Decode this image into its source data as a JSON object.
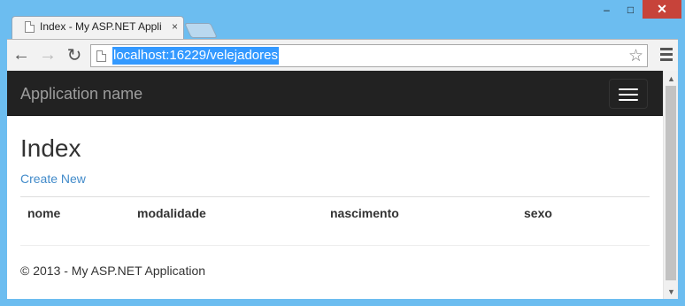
{
  "tab": {
    "title": "Index - My ASP.NET Appli",
    "close": "×"
  },
  "window": {
    "minimize": "–",
    "maximize": "□",
    "close": "✕"
  },
  "toolbar": {
    "back": "←",
    "forward": "→",
    "reload": "↻",
    "url": "localhost:16229/velejadores",
    "star": "☆"
  },
  "navbar": {
    "brand": "Application name"
  },
  "page": {
    "heading": "Index",
    "create_link": "Create New",
    "table": {
      "columns": [
        "nome",
        "modalidade",
        "nascimento",
        "sexo"
      ]
    },
    "footer": "© 2013 - My ASP.NET Application"
  },
  "scrollbar": {
    "up": "▲",
    "down": "▼"
  }
}
